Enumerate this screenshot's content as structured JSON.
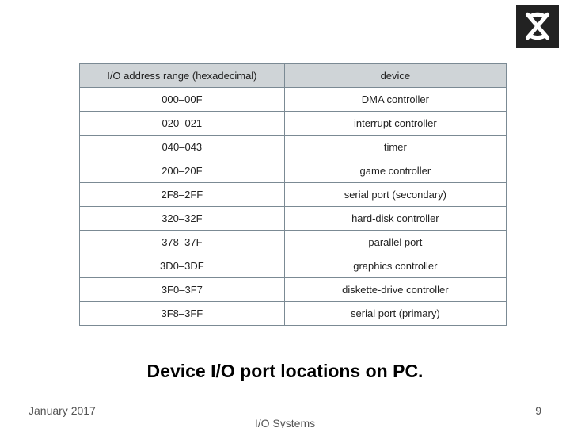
{
  "chart_data": {
    "type": "table",
    "title": "Device I/O port locations on PC.",
    "columns": [
      "I/O address range (hexadecimal)",
      "device"
    ],
    "rows": [
      [
        "000–00F",
        "DMA controller"
      ],
      [
        "020–021",
        "interrupt controller"
      ],
      [
        "040–043",
        "timer"
      ],
      [
        "200–20F",
        "game controller"
      ],
      [
        "2F8–2FF",
        "serial port (secondary)"
      ],
      [
        "320–32F",
        "hard-disk controller"
      ],
      [
        "378–37F",
        "parallel port"
      ],
      [
        "3D0–3DF",
        "graphics controller"
      ],
      [
        "3F0–3F7",
        "diskette-drive controller"
      ],
      [
        "3F8–3FF",
        "serial port (primary)"
      ]
    ]
  },
  "caption": "Device I/O port locations on PC.",
  "footer": {
    "date": "January 2017",
    "center": "I/O Systems",
    "page": "9"
  }
}
